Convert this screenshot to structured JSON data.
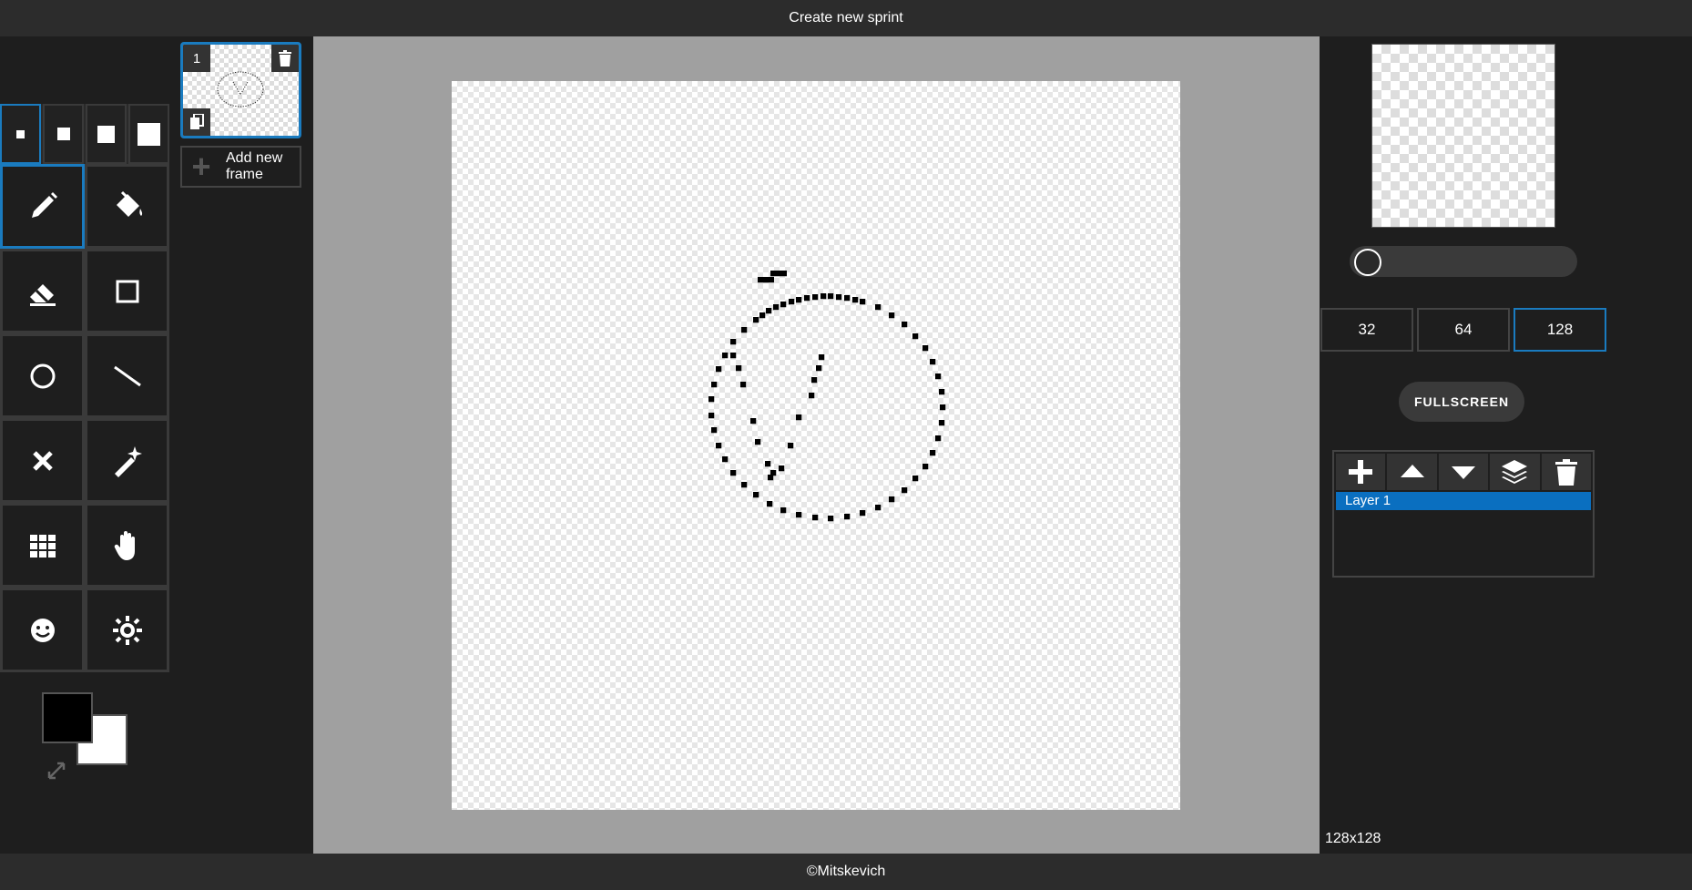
{
  "header": {
    "title": "Create new sprint"
  },
  "footer": {
    "copyright": "©Mitskevich"
  },
  "brush_sizes": [
    {
      "name": "brush-size-1",
      "dot": 9,
      "active": true
    },
    {
      "name": "brush-size-2",
      "dot": 14,
      "active": false
    },
    {
      "name": "brush-size-3",
      "dot": 19,
      "active": false
    },
    {
      "name": "brush-size-4",
      "dot": 25,
      "active": false
    }
  ],
  "tools": [
    {
      "name": "pencil-tool",
      "icon": "pencil-icon",
      "active": true
    },
    {
      "name": "fill-tool",
      "icon": "paint-bucket-icon",
      "active": false
    },
    {
      "name": "eraser-tool",
      "icon": "eraser-icon",
      "active": false
    },
    {
      "name": "rectangle-tool",
      "icon": "square-icon",
      "active": false
    },
    {
      "name": "circle-tool",
      "icon": "circle-icon",
      "active": false
    },
    {
      "name": "line-tool",
      "icon": "line-icon",
      "active": false
    },
    {
      "name": "clear-tool",
      "icon": "close-icon",
      "active": false
    },
    {
      "name": "magic-wand-tool",
      "icon": "magic-wand-icon",
      "active": false
    },
    {
      "name": "grid-tool",
      "icon": "grid-icon",
      "active": false
    },
    {
      "name": "pan-tool",
      "icon": "hand-icon",
      "active": false
    },
    {
      "name": "emoji-tool",
      "icon": "smiley-icon",
      "active": false
    },
    {
      "name": "brightness-tool",
      "icon": "sun-icon",
      "active": false
    }
  ],
  "colors": {
    "primary": "#000000",
    "secondary": "#ffffff",
    "accent": "#1a7bbf"
  },
  "frames": {
    "items": [
      {
        "number": "1"
      }
    ],
    "add_label": "Add new\nframe"
  },
  "resolution": {
    "options": [
      "32",
      "64",
      "128"
    ],
    "selected": "128",
    "display": "128x128"
  },
  "fullscreen_label": "FULLSCREEN",
  "layers": {
    "items": [
      {
        "label": "Layer 1",
        "selected": true
      }
    ]
  }
}
